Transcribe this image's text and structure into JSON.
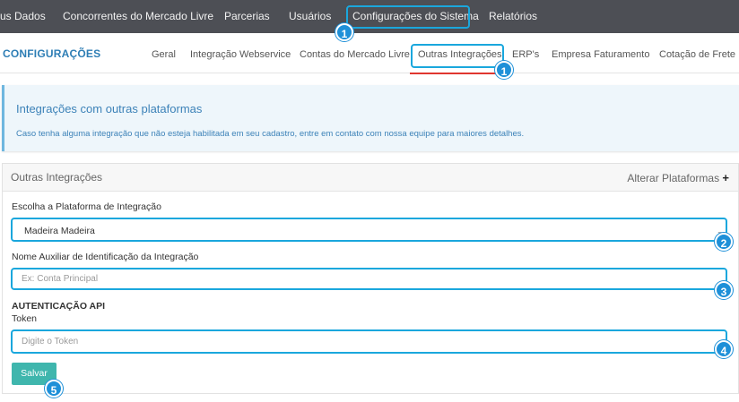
{
  "topnav": {
    "items": [
      "us Dados",
      "Concorrentes do Mercado Livre",
      "Parcerias",
      "Usuários",
      "Configurações do Sistema",
      "Relatórios"
    ]
  },
  "secnav": {
    "brand": "CONFIGURAÇÕES",
    "tabs": [
      "Geral",
      "Integração Webservice",
      "Contas do Mercado Livre",
      "Outras Integrações",
      "ERP's",
      "Empresa Faturamento",
      "Cotação de Frete"
    ]
  },
  "info": {
    "title": "Integrações com outras plataformas",
    "text": "Caso tenha alguma integração que não esteja habilitada em seu cadastro, entre em contato com nossa equipe para maiores detalhes."
  },
  "panel": {
    "title": "Outras Integrações",
    "action": "Alterar Plataformas",
    "action_icon": "plus-icon",
    "platform_label": "Escolha a Plataforma de Integração",
    "platform_value": "Madeira Madeira",
    "alias_label": "Nome Auxiliar de Identificação da Integração",
    "alias_placeholder": "Ex: Conta Principal",
    "auth_heading": "AUTENTICAÇÃO API",
    "token_label": "Token",
    "token_placeholder": "Digite o Token",
    "save_label": "Salvar"
  },
  "badges": [
    "1",
    "1",
    "2",
    "3",
    "4",
    "5"
  ],
  "colors": {
    "topnav_bg": "#4d4f55",
    "highlight": "#1aa7dd",
    "badge": "#1e90d8",
    "brand": "#2e7eb5",
    "save_button": "#3fb6ad",
    "info_bg": "#eef6fb"
  }
}
